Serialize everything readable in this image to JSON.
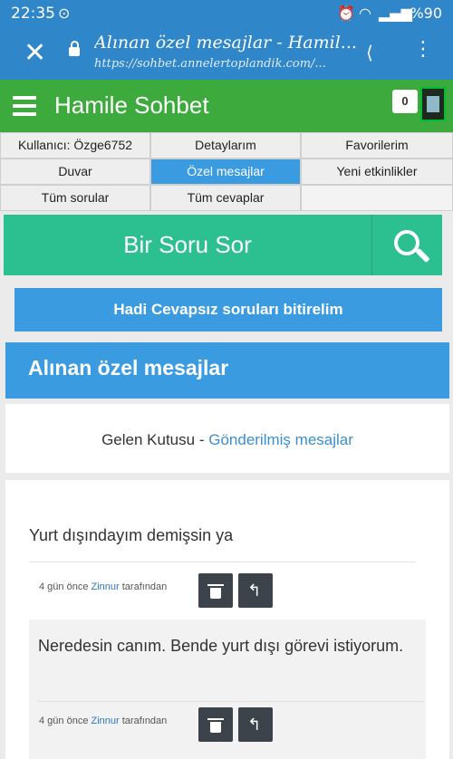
{
  "statusbar": {
    "time": "22:35",
    "battery": "%90"
  },
  "browser": {
    "page_title": "Alınan özel mesajlar - Hamil...",
    "url": "https://sohbet.annelertoplandik.com/..."
  },
  "site": {
    "name": "Hamile Sohbet",
    "notification_count": "0"
  },
  "nav": {
    "rows": [
      [
        "Kullanıcı: Özge6752",
        "Detaylarım",
        "Favorilerim"
      ],
      [
        "Duvar",
        "Özel mesajlar",
        "Yeni etkinlikler"
      ],
      [
        "Tüm sorular",
        "Tüm cevaplar",
        ""
      ]
    ],
    "active": "Özel mesajlar"
  },
  "ask": {
    "label": "Bir Soru Sor"
  },
  "cta": {
    "label": "Hadi Cevapsız soruları bitirelim"
  },
  "section": {
    "title": "Alınan özel mesajlar"
  },
  "mailbox": {
    "inbox_label": "Gelen Kutusu",
    "separator": "-",
    "sent_label": "Gönderilmiş mesajlar"
  },
  "messages": [
    {
      "text": "Yurt dışındayım demişsin ya",
      "time": "4 gün önce",
      "author": "Zinnur",
      "suffix": "tarafından"
    },
    {
      "text": "Neredesin canım. Bende yurt dışı görevi istiyorum.",
      "time": "4 gün önce",
      "author": "Zinnur",
      "suffix": "tarafından"
    }
  ],
  "colors": {
    "browser_bar": "#2f86c8",
    "site_header": "#3caa3c",
    "ask_bar": "#2cbf8f",
    "primary_blue": "#3b9be0",
    "action_button": "#3c434a"
  }
}
